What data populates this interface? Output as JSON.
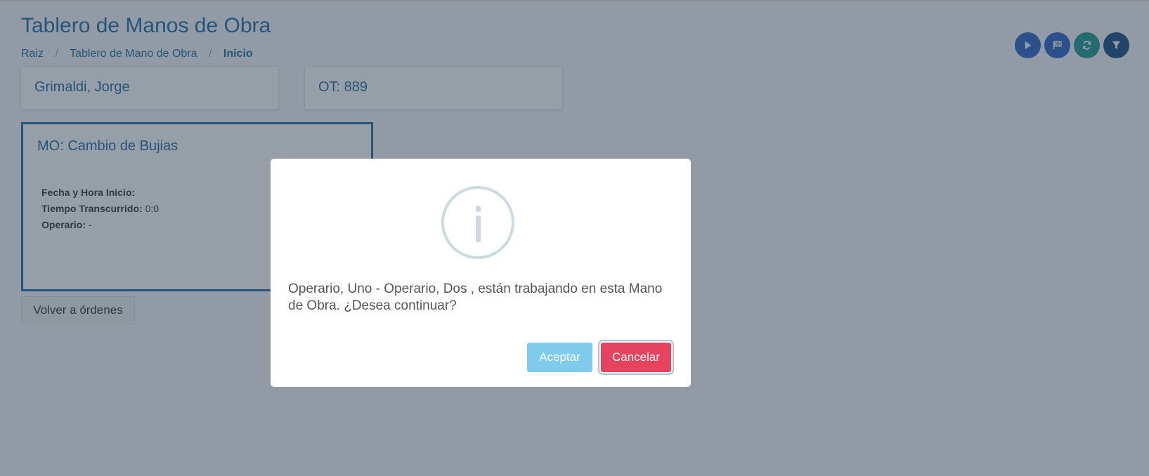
{
  "header": {
    "title": "Tablero de Manos de Obra",
    "breadcrumb": [
      "Raiz",
      "Tablero de Mano de Obra",
      "Inicio"
    ]
  },
  "toolbar": {
    "buttons": [
      {
        "icon": "play-icon",
        "color": "#2a63c4"
      },
      {
        "icon": "flag-icon",
        "color": "#2a63c4"
      },
      {
        "icon": "refresh-icon",
        "color": "#1b9a8f"
      },
      {
        "icon": "filter-icon",
        "color": "#154a80"
      }
    ]
  },
  "cards": {
    "employee": "Grimaldi, Jorge",
    "order": "OT: 889"
  },
  "mo_card": {
    "title": "MO: Cambio de Bujias",
    "start_label": "Fecha y Hora Inicio:",
    "start_value": "",
    "elapsed_label": "Tiempo Transcurrido:",
    "elapsed_value": "0:0",
    "operator_label": "Operario:",
    "operator_value": "-"
  },
  "back_button": "Volver a órdenes",
  "dialog": {
    "message": "Operario, Uno - Operario, Dos , están trabajando en esta Mano de Obra. ¿Desea continuar?",
    "confirm": "Aceptar",
    "cancel": "Cancelar",
    "icon": "info-icon"
  }
}
